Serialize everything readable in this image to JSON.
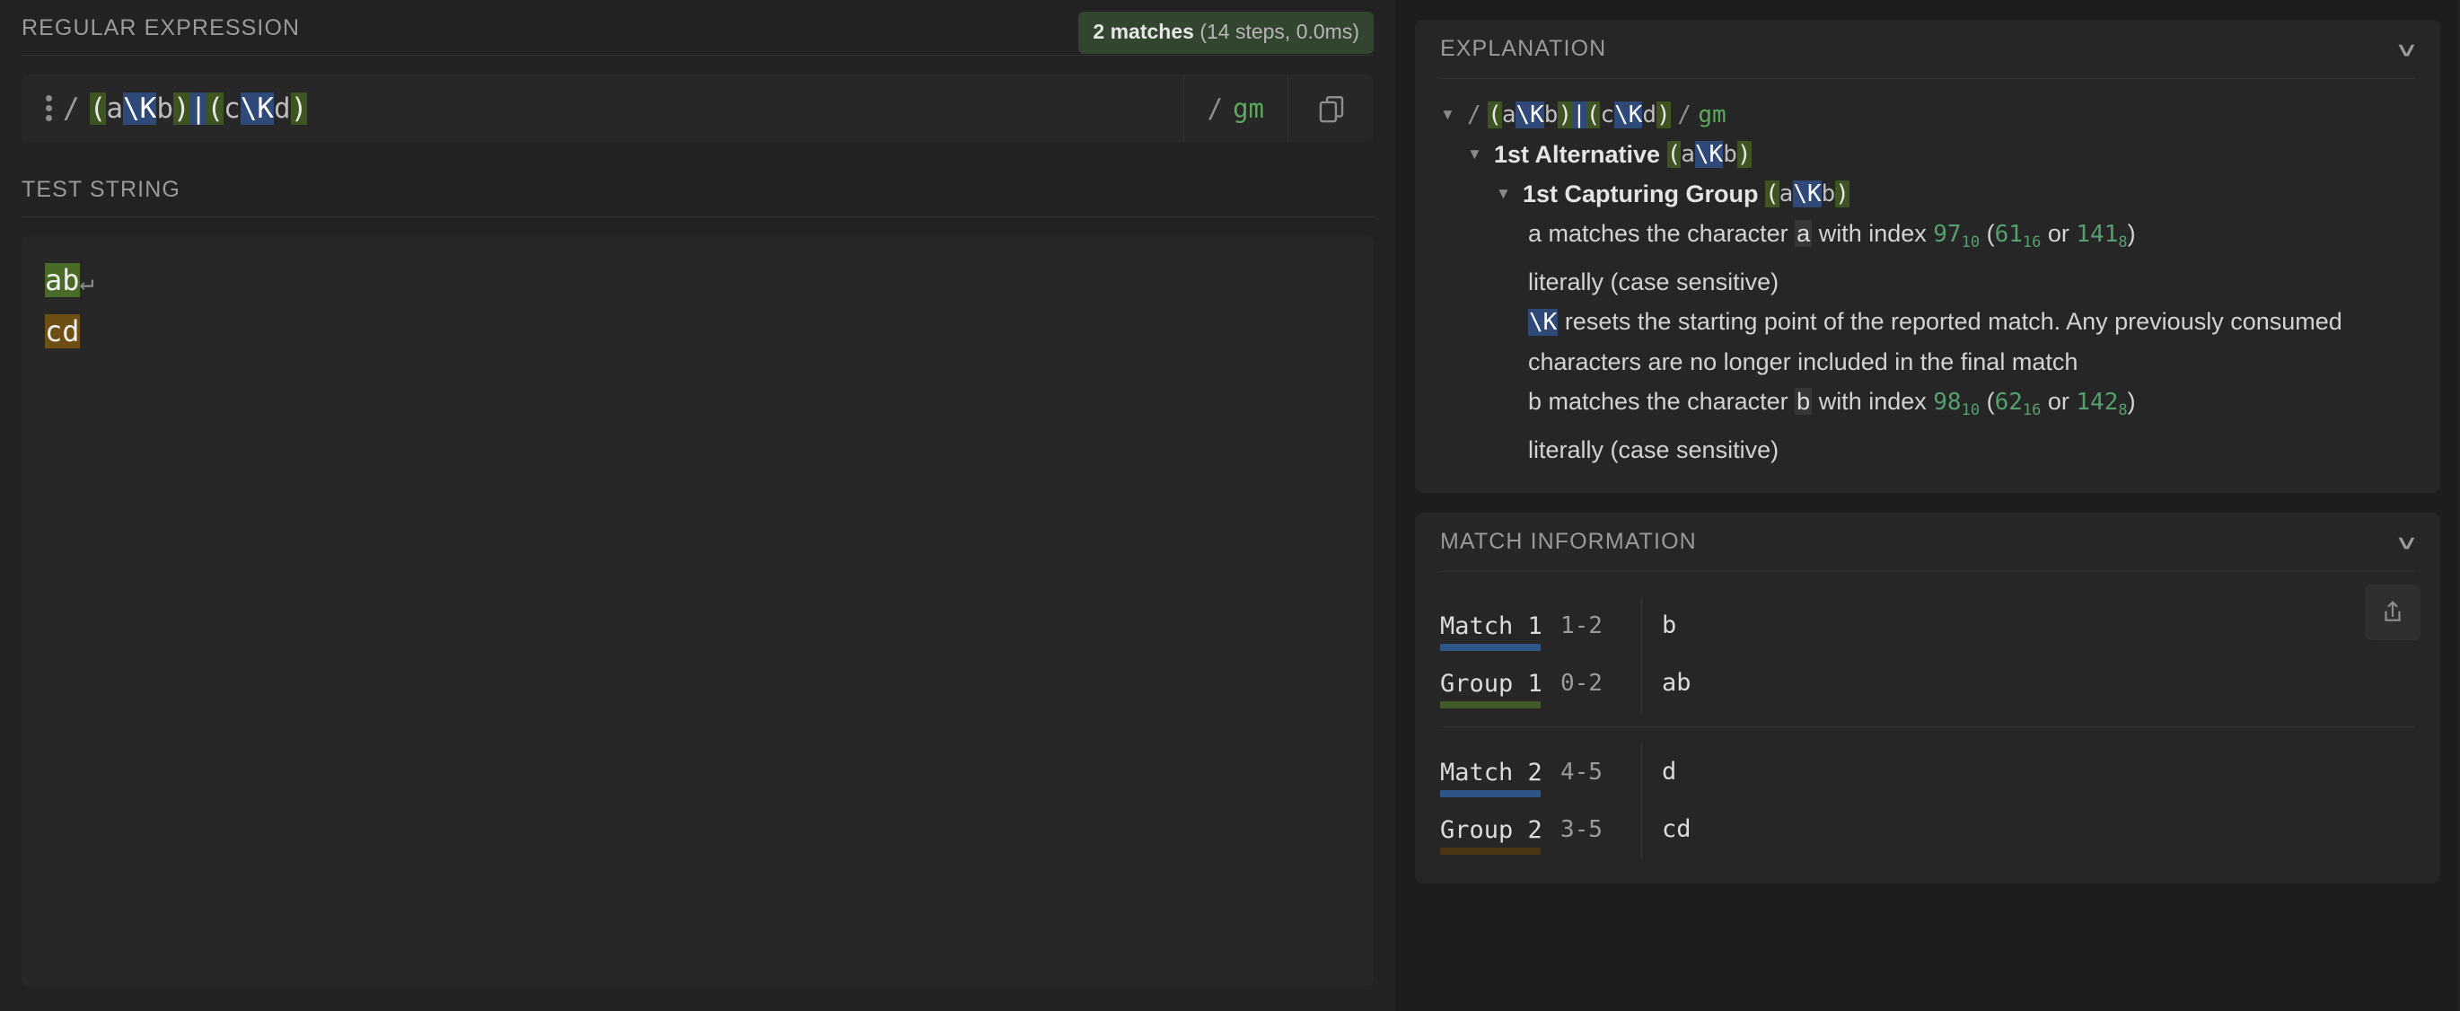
{
  "left": {
    "regex_section_title": "REGULAR EXPRESSION",
    "match_badge": {
      "count_label": "2 matches",
      "detail": "(14 steps, 0.0ms)"
    },
    "regex_input": {
      "delimiter": "/",
      "pattern": "(a\\Kb)|(c\\Kd)",
      "flags_slash": "/",
      "flags": "gm",
      "tokens": [
        {
          "t": "(",
          "style": "g"
        },
        {
          "t": "a",
          "style": "p"
        },
        {
          "t": "\\K",
          "style": "b"
        },
        {
          "t": "b",
          "style": "p"
        },
        {
          "t": ")",
          "style": "g"
        },
        {
          "t": "|",
          "style": "b"
        },
        {
          "t": "(",
          "style": "g"
        },
        {
          "t": "c",
          "style": "p"
        },
        {
          "t": "\\K",
          "style": "b"
        },
        {
          "t": "d",
          "style": "p"
        },
        {
          "t": ")",
          "style": "g"
        }
      ]
    },
    "test_section_title": "TEST STRING",
    "test_string": {
      "line1": "ab",
      "line1_newline_glyph": "↵",
      "line2": "cd"
    }
  },
  "right": {
    "explanation": {
      "title": "EXPLANATION",
      "chevron": "∨",
      "root": {
        "triangle": "▼",
        "slash_open": "/",
        "slash_close": "/",
        "flags": "gm"
      },
      "alternative": {
        "triangle": "▼",
        "label": "1st Alternative"
      },
      "capturing_group": {
        "triangle": "▼",
        "label": "1st Capturing Group"
      },
      "lines": [
        {
          "id": "a-match",
          "pre": "a matches the character ",
          "char": "a",
          "mid": " with index ",
          "dec": "97",
          "dec_sub": "10",
          "paren_open": "(",
          "hex": "61",
          "hex_sub": "16",
          "or": " or ",
          "oct": "141",
          "oct_sub": "8",
          "paren_close": ")"
        },
        {
          "id": "a-literally",
          "text": "literally (case sensitive)"
        },
        {
          "id": "k-reset",
          "kw": "\\K",
          "text": " resets the starting point of the reported match. Any previously consumed characters are no longer included in the final match"
        },
        {
          "id": "b-match",
          "pre": "b matches the character ",
          "char": "b",
          "mid": " with index ",
          "dec": "98",
          "dec_sub": "10",
          "paren_open": "(",
          "hex": "62",
          "hex_sub": "16",
          "or": " or ",
          "oct": "142",
          "oct_sub": "8",
          "paren_close": ")"
        },
        {
          "id": "b-literally",
          "text": "literally (case sensitive)"
        }
      ]
    },
    "match_information": {
      "title": "MATCH INFORMATION",
      "chevron": "∨",
      "share_icon": "share-icon",
      "groups": [
        {
          "rows": [
            {
              "label": "Match 1",
              "range": "1-2",
              "value": "b",
              "bar_color": "#2d5588"
            },
            {
              "label": "Group 1",
              "range": "0-2",
              "value": "ab",
              "bar_color": "#425a28"
            }
          ]
        },
        {
          "rows": [
            {
              "label": "Match 2",
              "range": "4-5",
              "value": "d",
              "bar_color": "#2d5588"
            },
            {
              "label": "Group 2",
              "range": "3-5",
              "value": "cd",
              "bar_color": "#4a3712"
            }
          ]
        }
      ]
    }
  },
  "colors": {
    "page_bg": "#222222",
    "panel_bg": "#1d1d1d",
    "card_bg": "#262626",
    "input_bg": "#272727",
    "group_green": "#3e5421",
    "escape_blue": "#2f4a78",
    "flag_green": "#5da85d",
    "badge_green": "#32452e",
    "highlight_green": "#4a6b28",
    "highlight_brown": "#6d4f14",
    "number_green": "#55a06c"
  }
}
